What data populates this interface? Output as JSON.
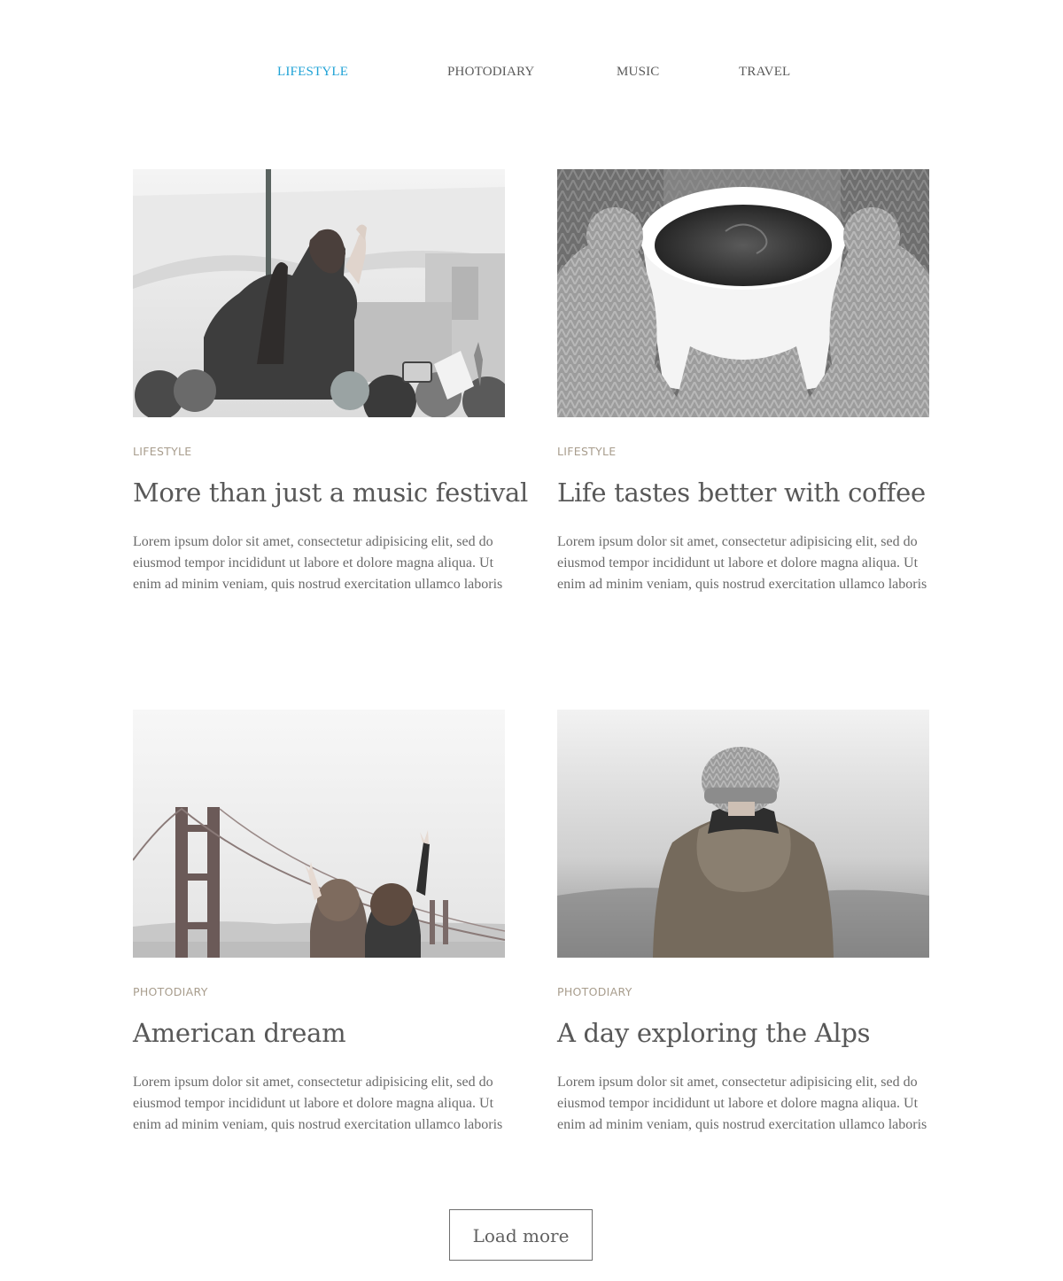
{
  "nav": {
    "items": [
      {
        "label": "LIFESTYLE",
        "active": true
      },
      {
        "label": "PHOTODIARY",
        "active": false
      },
      {
        "label": "MUSIC",
        "active": false
      },
      {
        "label": "TRAVEL",
        "active": false
      }
    ],
    "active_color": "#1fa2d6"
  },
  "posts": [
    {
      "category": "LIFESTYLE",
      "title": "More than just a music festival",
      "excerpt_lines": [
        "Lorem ipsum dolor sit amet, consectetur adipisicing elit, sed do",
        "eiusmod tempor incididunt ut labore et dolore magna aliqua. Ut",
        "enim ad minim veniam, quis nostrud exercitation ullamco laboris"
      ],
      "image": "concert-crowd-photo"
    },
    {
      "category": "LIFESTYLE",
      "title": "Life tastes better with coffee",
      "excerpt_lines": [
        "Lorem ipsum dolor sit amet, consectetur adipisicing elit, sed do",
        "eiusmod tempor incididunt ut labore et dolore magna aliqua. Ut",
        "enim ad minim veniam, quis nostrud exercitation ullamco laboris"
      ],
      "image": "coffee-cup-mittens-photo"
    },
    {
      "category": "PHOTODIARY",
      "title": "American dream",
      "excerpt_lines": [
        "Lorem ipsum dolor sit amet, consectetur adipisicing elit, sed do",
        "eiusmod tempor incididunt ut labore et dolore magna aliqua. Ut",
        "enim ad minim veniam, quis nostrud exercitation ullamco laboris"
      ],
      "image": "golden-gate-bridge-photo"
    },
    {
      "category": "PHOTODIARY",
      "title": "A day exploring the Alps",
      "excerpt_lines": [
        "Lorem ipsum dolor sit amet, consectetur adipisicing elit, sed do",
        "eiusmod tempor incididunt ut labore et dolore magna aliqua. Ut",
        "enim ad minim veniam, quis nostrud exercitation ullamco laboris"
      ],
      "image": "hiker-in-beanie-photo"
    }
  ],
  "load_more_label": "Load more"
}
